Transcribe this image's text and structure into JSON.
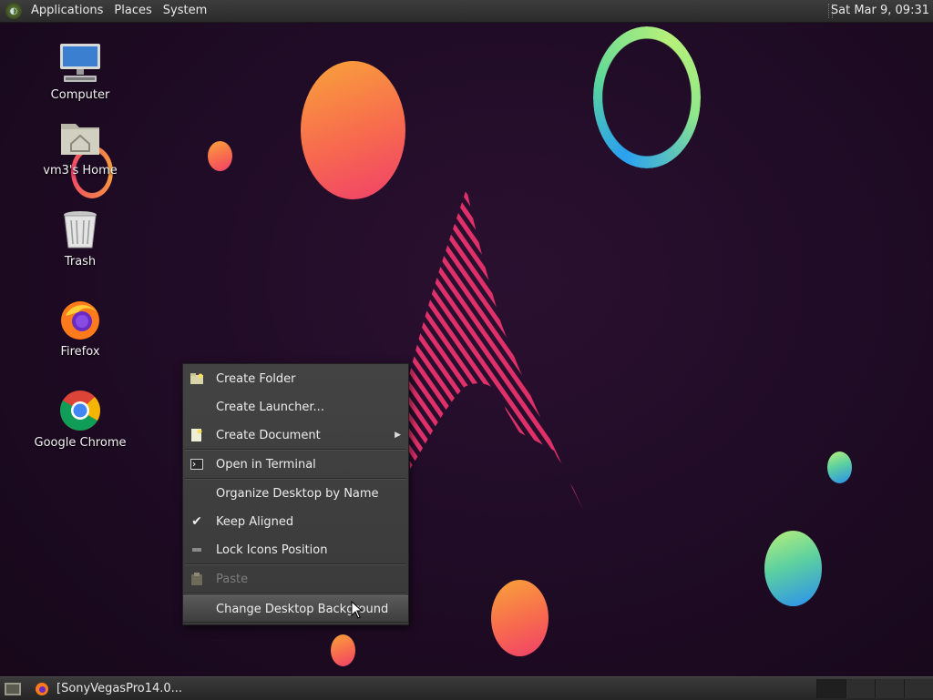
{
  "top_panel": {
    "menus": [
      "Applications",
      "Places",
      "System"
    ],
    "clock": "Sat Mar  9, 09:31"
  },
  "desktop_icons": [
    {
      "label": "Computer",
      "icon": "computer-icon"
    },
    {
      "label": "vm3's Home",
      "icon": "home-folder-icon"
    },
    {
      "label": "Trash",
      "icon": "trash-icon"
    },
    {
      "label": "Firefox",
      "icon": "firefox-icon"
    },
    {
      "label": "Google Chrome",
      "icon": "chrome-icon"
    }
  ],
  "context_menu": {
    "items": [
      {
        "label": "Create Folder",
        "icon": "new-folder-icon",
        "enabled": true
      },
      {
        "label": "Create Launcher...",
        "icon": "",
        "enabled": true
      },
      {
        "label": "Create Document",
        "icon": "new-document-icon",
        "enabled": true,
        "submenu": true
      },
      {
        "label": "Open in Terminal",
        "icon": "terminal-icon",
        "enabled": true
      },
      {
        "label": "Organize Desktop by Name",
        "icon": "",
        "enabled": true
      },
      {
        "label": "Keep Aligned",
        "icon": "checkmark-icon",
        "enabled": true,
        "checked": true
      },
      {
        "label": "Lock Icons Position",
        "icon": "lock-toggle-icon",
        "enabled": true
      },
      {
        "label": "Paste",
        "icon": "clipboard-icon",
        "enabled": false
      },
      {
        "label": "Change Desktop Background",
        "icon": "",
        "enabled": true,
        "highlighted": true
      }
    ]
  },
  "bottom_panel": {
    "task_label": "[SonyVegasPro14.0...",
    "workspace_count": 4
  },
  "colors": {
    "background": "#1e0b24",
    "panel": "#2b2b2b",
    "accent_orange": "#f76a4e",
    "accent_pink": "#e0306a"
  }
}
